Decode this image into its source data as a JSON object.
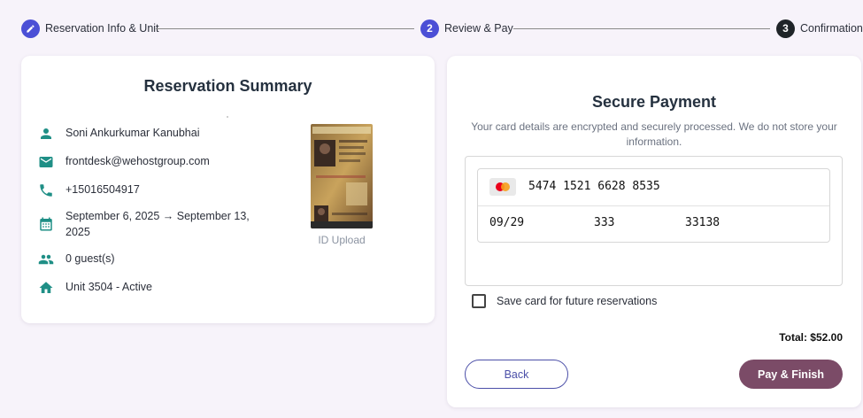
{
  "stepper": {
    "steps": [
      {
        "number": "",
        "icon": "pencil-icon",
        "label": "Reservation Info & Unit",
        "state": "completed",
        "color": "#4b4fd6"
      },
      {
        "number": "2",
        "label": "Review & Pay",
        "state": "active",
        "color": "#4b4fd6"
      },
      {
        "number": "3",
        "label": "Confirmation",
        "state": "pending",
        "color": "#1f2428"
      }
    ]
  },
  "summary": {
    "title": "Reservation Summary",
    "guest_name": "Soni Ankurkumar Kanubhai",
    "email": "frontdesk@wehostgroup.com",
    "phone": "+15016504917",
    "dates": "September 6, 2025 → September 13, 2025",
    "guests": "0 guest(s)",
    "unit": "Unit 3504 - Active",
    "id_caption": "ID Upload",
    "icon_color": "#1f8f86"
  },
  "payment": {
    "title": "Secure Payment",
    "subtitle": "Your card details are encrypted and securely processed. We do not store your information.",
    "card_brand": "mastercard-icon",
    "card_number": "5474 1521 6628 8535",
    "expiry": "09/29",
    "cvc": "333",
    "zip": "33138",
    "save_card_label": "Save card for future reservations",
    "save_card_checked": false,
    "total": "Total: $52.00",
    "back_label": "Back",
    "pay_label": "Pay & Finish",
    "accent": "#4b4fa8",
    "pay_color": "#7b4b67"
  }
}
